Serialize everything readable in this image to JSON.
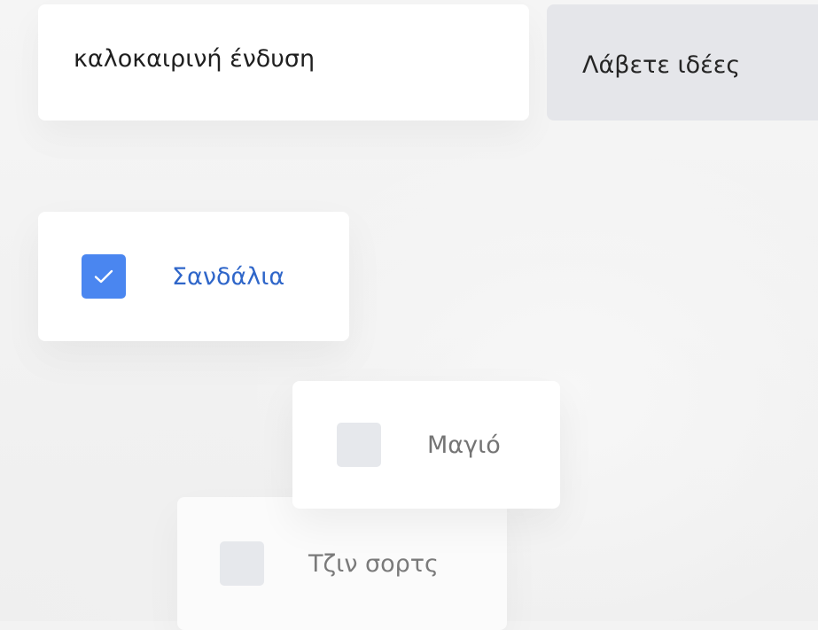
{
  "search": {
    "value": "καλοκαιρινή ένδυση",
    "placeholder": "καλοκαιρινή ένδυση"
  },
  "ideas_button": {
    "label": "Λάβετε ιδέες"
  },
  "suggestions": [
    {
      "label": "Σανδάλια",
      "checked": true
    },
    {
      "label": "Μαγιό",
      "checked": false
    },
    {
      "label": "Τζιν σορτς",
      "checked": false
    }
  ],
  "colors": {
    "checked_box": "#4a86f0",
    "checked_label": "#2f66c9",
    "unchecked_box": "#e6e8ec",
    "button_bg": "#e5e6ea",
    "page_bg": "#f3f3f3"
  },
  "icons": {
    "checkmark": "checkmark-icon"
  }
}
